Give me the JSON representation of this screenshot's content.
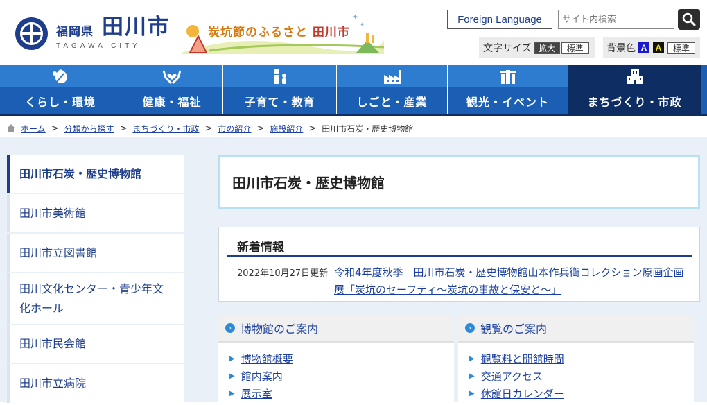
{
  "header": {
    "logo_pref": "福岡県",
    "logo_city": "田川市",
    "logo_roman": "TAGAWA CITY",
    "banner_text_a": "炭坑節のふるさと",
    "banner_text_b": "田川市",
    "foreign_language": "Foreign Language",
    "search_placeholder": "サイト内検索",
    "fontsize_label": "文字サイズ",
    "fontsize_large": "拡大",
    "fontsize_standard": "標準",
    "bgcolor_label": "背景色",
    "bg_option_a1": "A",
    "bg_option_a2": "A",
    "bgcolor_standard": "標準"
  },
  "nav": [
    {
      "label": "くらし・環境",
      "icon": "leaf-drop-icon"
    },
    {
      "label": "健康・福祉",
      "icon": "hands-heart-icon"
    },
    {
      "label": "子育て・教育",
      "icon": "parent-child-icon"
    },
    {
      "label": "しごと・産業",
      "icon": "factory-icon"
    },
    {
      "label": "観光・イベント",
      "icon": "landmark-icon"
    },
    {
      "label": "まちづくり・市政",
      "icon": "building-icon"
    }
  ],
  "breadcrumb": {
    "home": "ホーム",
    "items": [
      "分類から探す",
      "まちづくり・市政",
      "市の紹介",
      "施設紹介"
    ],
    "current": "田川市石炭・歴史博物館"
  },
  "sidebar": {
    "items": [
      "田川市石炭・歴史博物館",
      "田川市美術館",
      "田川市立図書館",
      "田川文化センター・青少年文化ホール",
      "田川市民会館",
      "田川市立病院"
    ]
  },
  "main": {
    "title": "田川市石炭・歴史博物館",
    "news_heading": "新着情報",
    "news_date": "2022年10月27日更新",
    "news_link": "令和4年度秋季　田川市石炭・歴史博物館山本作兵衛コレクション原画企画展「炭坑のセーフティ～炭坑の事故と保安と～」",
    "card_museum": {
      "heading": "博物館のご案内",
      "items": [
        "博物館概要",
        "館内案内",
        "展示室"
      ]
    },
    "card_visit": {
      "heading": "観覧のご案内",
      "items": [
        "観覧料と開館時間",
        "交通アクセス",
        "休館日カレンダー"
      ]
    }
  },
  "colors": {
    "primary": "#1e3e8c",
    "nav": "#1b5fb5",
    "nav_band": "#2e7cd0",
    "nav_active": "#0e2d63",
    "link": "#1a3fa0"
  }
}
